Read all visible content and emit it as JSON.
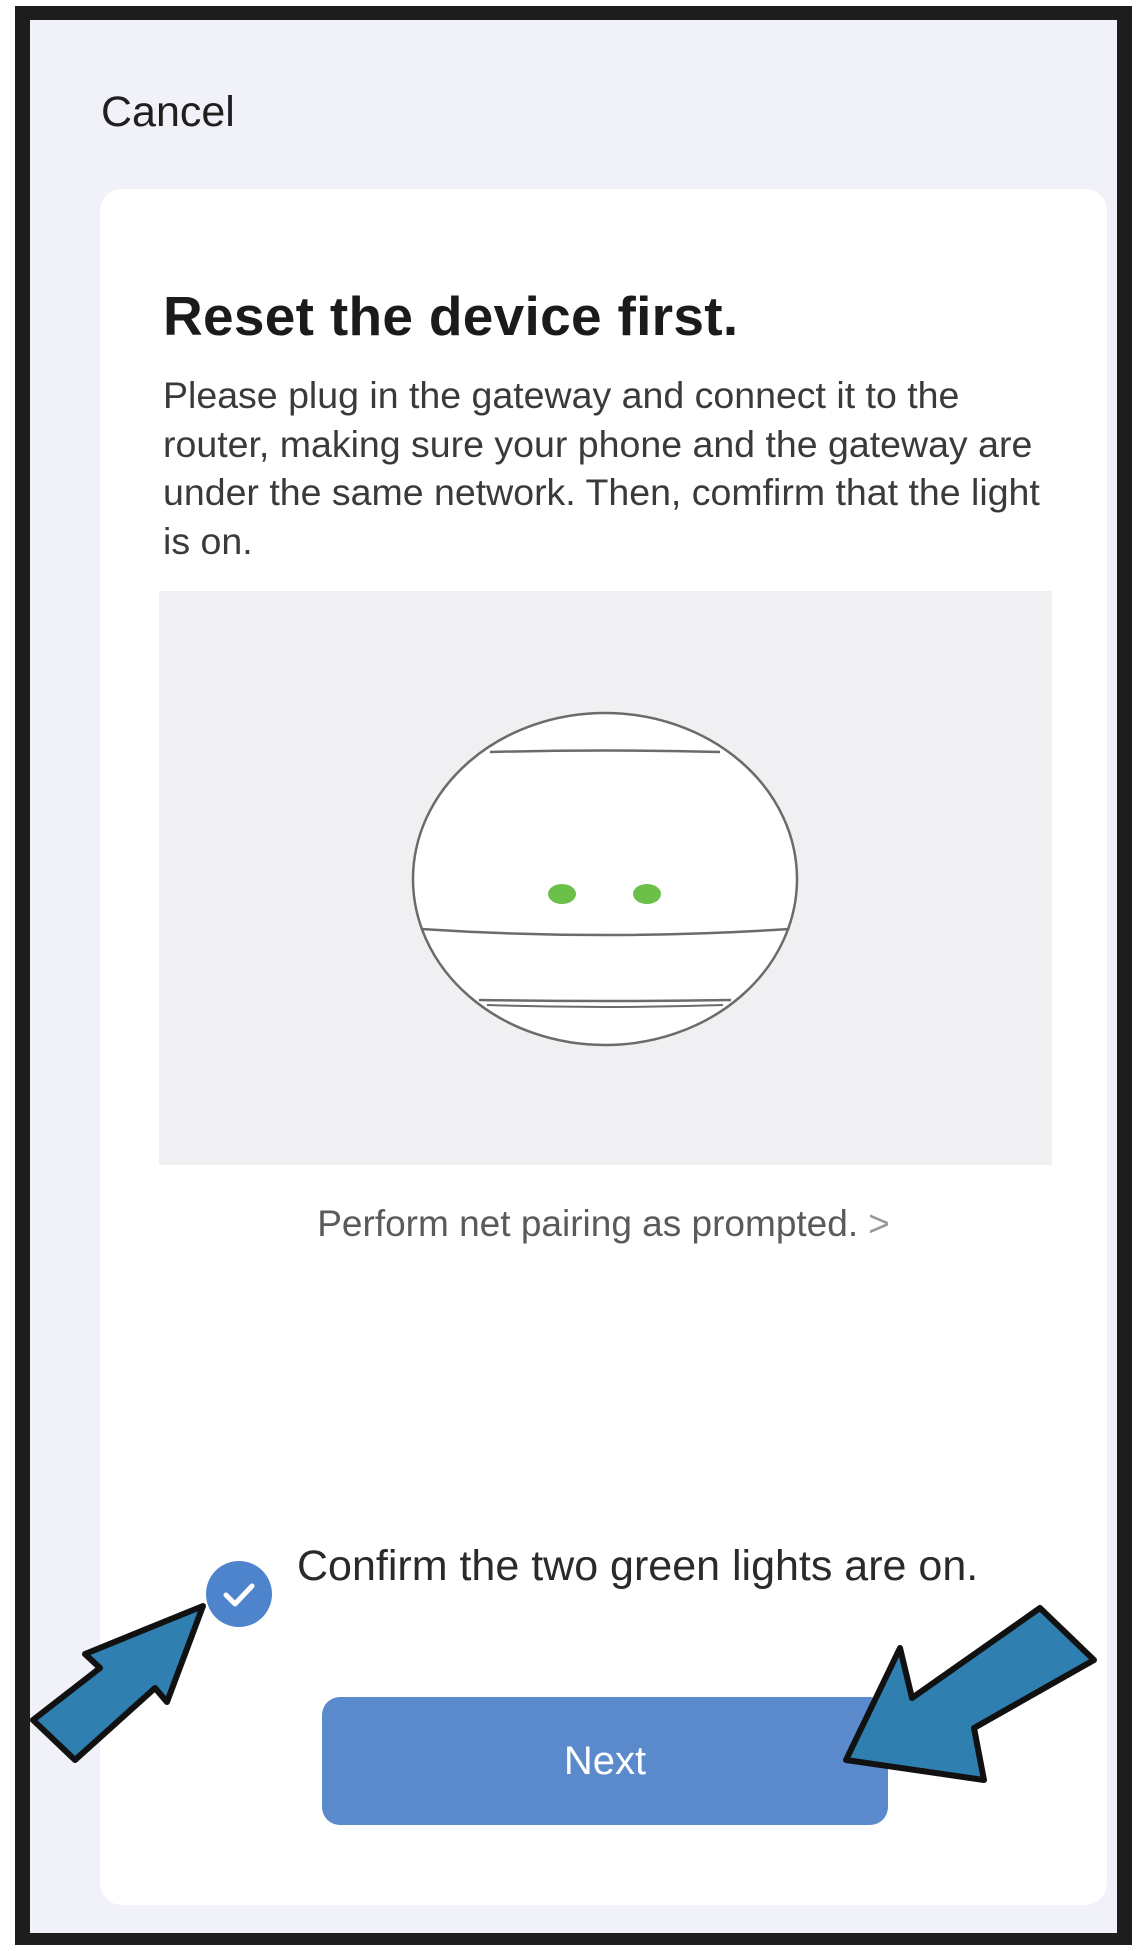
{
  "header": {
    "cancel_label": "Cancel"
  },
  "card": {
    "title": "Reset the device first.",
    "description": "Please plug in the gateway and connect it to the router, making sure your phone and the gateway are under the same network. Then, comfirm that the light is on.",
    "illustration": {
      "subject": "gateway-device",
      "lights_on": 2,
      "light_color": "#6cc04a"
    },
    "pairing_link_label": "Perform net pairing as prompted.",
    "pairing_link_icon": "chevron-right-icon",
    "confirm": {
      "checked": true,
      "label": "Confirm the two green lights are on.",
      "accent_color": "#4e84cc"
    },
    "next_label": "Next"
  },
  "annotations": {
    "arrow_color": "#2f7fb0",
    "arrows": [
      "arrow-to-checkbox",
      "arrow-to-next-button"
    ]
  }
}
